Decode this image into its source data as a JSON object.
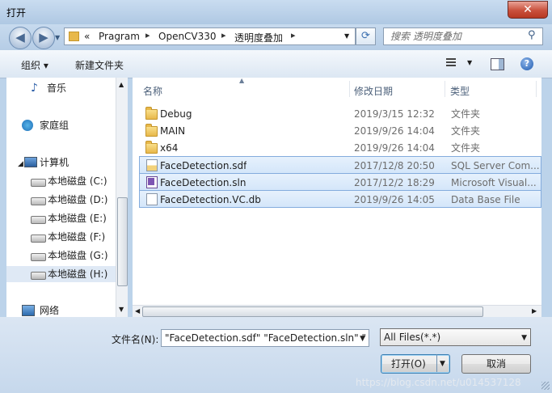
{
  "window": {
    "title": "打开",
    "close_glyph": "✕"
  },
  "nav": {
    "back_glyph": "◀",
    "forward_glyph": "▶",
    "breadcrumb": [
      "Pragram",
      "OpenCV330",
      "透明度叠加"
    ],
    "overflow_glyph": "«",
    "search_placeholder": "搜索 透明度叠加"
  },
  "toolbar": {
    "organize": "组织 ▾",
    "new_folder": "新建文件夹"
  },
  "sidebar": {
    "favorites_label": "音乐",
    "homegroup": "家庭组",
    "computer": "计算机",
    "drives": [
      "本地磁盘 (C:)",
      "本地磁盘 (D:)",
      "本地磁盘 (E:)",
      "本地磁盘 (F:)",
      "本地磁盘 (G:)",
      "本地磁盘 (H:)"
    ],
    "network": "网络"
  },
  "columns": {
    "name": "名称",
    "modified": "修改日期",
    "type": "类型"
  },
  "files": [
    {
      "name": "Debug",
      "date": "2019/3/15 12:32",
      "type": "文件夹"
    },
    {
      "name": "MAIN",
      "date": "2019/9/26 14:04",
      "type": "文件夹"
    },
    {
      "name": "x64",
      "date": "2019/9/26 14:04",
      "type": "文件夹"
    },
    {
      "name": "FaceDetection.sdf",
      "date": "2017/12/8 20:50",
      "type": "SQL Server Com..."
    },
    {
      "name": "FaceDetection.sln",
      "date": "2017/12/2 18:29",
      "type": "Microsoft Visual..."
    },
    {
      "name": "FaceDetection.VC.db",
      "date": "2019/9/26 14:05",
      "type": "Data Base File"
    }
  ],
  "footer": {
    "filename_label": "文件名(N):",
    "filename_value": "\"FaceDetection.sdf\" \"FaceDetection.sln\" \"",
    "filetype_value": "All Files(*.*)",
    "open_button": "打开(O)",
    "cancel_button": "取消",
    "watermark": "https://blog.csdn.net/u014537128"
  },
  "colors": {
    "selection": "#d4e6fa",
    "selection_border": "#84acdd",
    "chrome": "#bcd3ea"
  }
}
